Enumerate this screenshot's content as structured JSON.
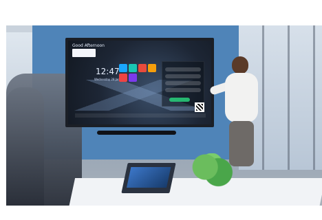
{
  "screen": {
    "header_text": "Good Afternoon",
    "clock_time": "12:47",
    "date_text": "Wednesday 28 January",
    "apps": [
      {
        "name": "skype-icon",
        "color": "#1aa7ff"
      },
      {
        "name": "teams-icon",
        "color": "#1ac7b4"
      },
      {
        "name": "stop-icon",
        "color": "#e94b3c"
      },
      {
        "name": "powerpoint-icon",
        "color": "#f59e0b"
      },
      {
        "name": "office-icon",
        "color": "#ef4444"
      },
      {
        "name": "onedrive-icon",
        "color": "#7c3aed"
      }
    ]
  }
}
